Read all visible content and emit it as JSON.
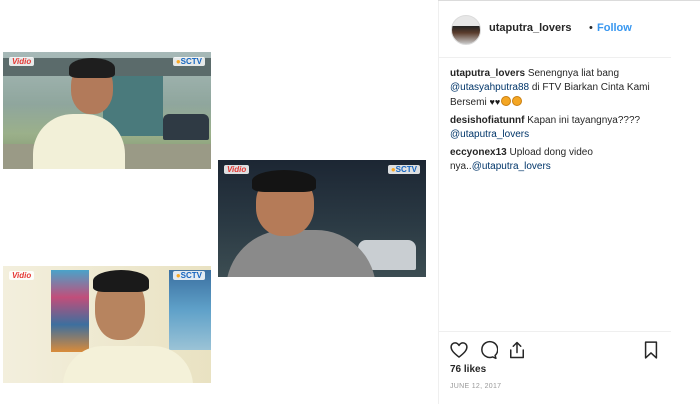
{
  "post": {
    "frames": [
      {
        "logo_left": "Vidio",
        "logo_right": "SCTV"
      },
      {
        "logo_left": "Vidio",
        "logo_right": "SCTV"
      },
      {
        "logo_left": "Vidio",
        "logo_right": "SCTV"
      }
    ]
  },
  "header": {
    "username": "utaputra_lovers",
    "separator": "•",
    "follow_label": "Follow"
  },
  "comments": [
    {
      "username": "utaputra_lovers",
      "text_before": "Senengnya liat bang",
      "mention": "@utasyahputra88",
      "text_after": "di FTV Biarkan Cinta Kami Bersemi",
      "emoji": [
        "black-heart",
        "black-heart",
        "grinning-face",
        "grinning-face"
      ]
    },
    {
      "username": "desishofiatunnf",
      "text_before": "Kapan ini tayangnya????",
      "mention": "@utaputra_lovers",
      "text_after": ""
    },
    {
      "username": "eccyonex13",
      "text_before": "Upload dong video nya..",
      "mention": "@utaputra_lovers",
      "text_after": ""
    }
  ],
  "actions": {
    "icons": [
      "heart-icon",
      "comment-icon",
      "share-icon",
      "bookmark-icon"
    ]
  },
  "likes": "76 likes",
  "date": "JUNE 12, 2017",
  "colors": {
    "link": "#3897f0",
    "mention": "#003569",
    "text": "#262626",
    "muted": "#999999",
    "border": "#efefef"
  }
}
